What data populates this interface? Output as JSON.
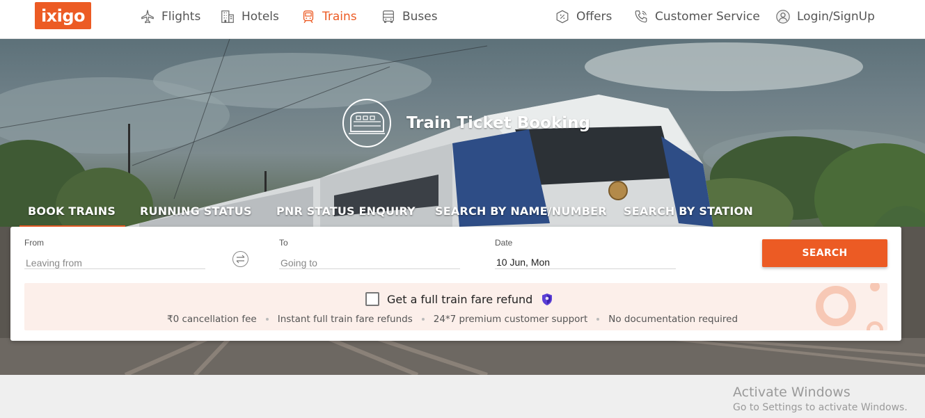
{
  "brand": {
    "logo_text": "ixigo",
    "accent_color": "#ec5b24"
  },
  "nav": {
    "left": [
      {
        "label": "Flights",
        "icon": "airplane-icon"
      },
      {
        "label": "Hotels",
        "icon": "building-icon"
      },
      {
        "label": "Trains",
        "icon": "train-icon",
        "active": true
      },
      {
        "label": "Buses",
        "icon": "bus-icon"
      }
    ],
    "right": [
      {
        "label": "Offers",
        "icon": "discount-badge-icon"
      },
      {
        "label": "Customer Service",
        "icon": "phone-icon"
      },
      {
        "label": "Login/SignUp",
        "icon": "user-icon"
      }
    ]
  },
  "hero": {
    "title": "Train Ticket Booking",
    "emblem_icon": "train-icon"
  },
  "tabs": [
    {
      "label": "BOOK TRAINS",
      "active": true
    },
    {
      "label": "RUNNING STATUS"
    },
    {
      "label": "PNR STATUS ENQUIRY"
    },
    {
      "label": "SEARCH BY NAME/NUMBER"
    },
    {
      "label": "SEARCH BY STATION"
    }
  ],
  "search_form": {
    "from": {
      "label": "From",
      "placeholder": "Leaving from",
      "value": ""
    },
    "to": {
      "label": "To",
      "placeholder": "Going to",
      "value": ""
    },
    "date": {
      "label": "Date",
      "value": "10 Jun, Mon"
    },
    "swap_icon": "swap-arrows-icon",
    "search_label": "SEARCH"
  },
  "refund_offer": {
    "checked": false,
    "title": "Get a full train fare refund",
    "badge_icon": "shield-icon",
    "points": [
      "₹0 cancellation fee",
      "Instant full train fare refunds",
      "24*7 premium customer support",
      "No documentation required"
    ]
  },
  "os_watermark": {
    "title": "Activate Windows",
    "subtitle": "Go to Settings to activate Windows."
  }
}
